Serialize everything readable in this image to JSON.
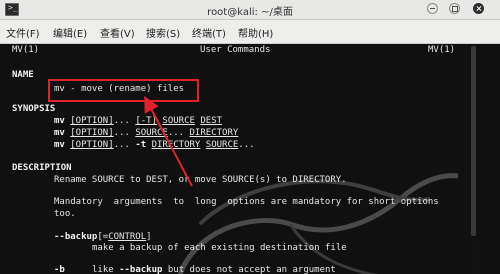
{
  "window": {
    "title": "root@kali: ~/桌面"
  },
  "menu": [
    "文件(F)",
    "编辑(E)",
    "查看(V)",
    "搜索(S)",
    "终端(T)",
    "帮助(H)"
  ],
  "man": {
    "header_left": "MV(1)",
    "header_center": "User Commands",
    "header_right": "MV(1)",
    "name_heading": "NAME",
    "name_line": "mv - move (rename) files",
    "synopsis_heading": "SYNOPSIS",
    "syn1": {
      "cmd": "mv",
      "opt": "[OPTION]",
      "dots": "...",
      "t": "[-T]",
      "src": "SOURCE",
      "dst": "DEST"
    },
    "syn2": {
      "cmd": "mv",
      "opt": "[OPTION]",
      "dots": "...",
      "src": "SOURCE",
      "dots2": "...",
      "dir": "DIRECTORY"
    },
    "syn3": {
      "cmd": "mv",
      "opt": "[OPTION]",
      "dots": "...",
      "t": "-t",
      "dir": "DIRECTORY",
      "src": "SOURCE",
      "dots2": "..."
    },
    "description_heading": "DESCRIPTION",
    "desc1": "Rename SOURCE to DEST, or move SOURCE(s) to DIRECTORY.",
    "desc2": "Mandatory  arguments  to  long  options are mandatory for short options",
    "desc3": "too.",
    "backup_opt": "--backup",
    "backup_arg": "CONTROL",
    "backup_desc": "make a backup of each existing destination file",
    "b_opt": "-b",
    "b_desc_pre": "like ",
    "b_desc_bold": "--backup",
    "b_desc_post": " but does not accept an argument"
  },
  "colors": {
    "annotation": "#e0212b"
  }
}
